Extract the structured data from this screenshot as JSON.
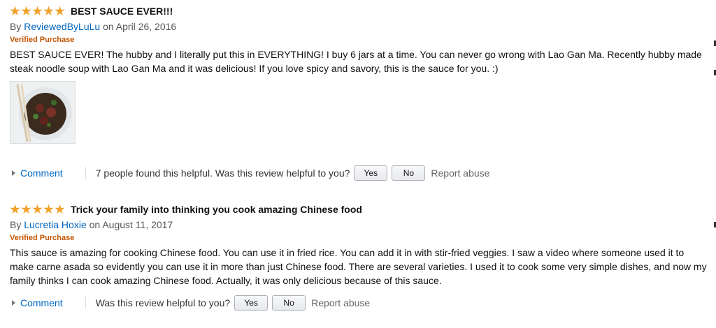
{
  "reviews": [
    {
      "stars": 5,
      "title": "BEST SAUCE EVER!!!",
      "by": "By",
      "author": "ReviewedByLuLu",
      "date": "on April 26, 2016",
      "verified": "Verified Purchase",
      "body": "BEST SAUCE EVER! The hubby and I literally put this in EVERYTHING! I buy 6 jars at a time. You can never go wrong with Lao Gan Ma. Recently hubby made steak noodle soup with Lao Gan Ma and it was delicious! If you love spicy and savory, this is the sauce for you. :)",
      "comment": "Comment",
      "helpful": "7 people found this helpful. Was this review helpful to you?",
      "yes": "Yes",
      "no": "No",
      "report": "Report abuse"
    },
    {
      "stars": 5,
      "title": "Trick your family into thinking you cook amazing Chinese food",
      "by": "By",
      "author": "Lucretia Hoxie",
      "date": "on August 11, 2017",
      "verified": "Verified Purchase",
      "body": "This sauce is amazing for cooking Chinese food. You can use it in fried rice. You can add it in with stir-fried veggies. I saw a video where someone used it to make carne asada so evidently you can use it in more than just Chinese food. There are several varieties. I used it to cook some very simple dishes, and now my family thinks I can cook amazing Chinese food. Actually, it was only delicious because of this sauce.",
      "comment": "Comment",
      "helpful": "Was this review helpful to you?",
      "yes": "Yes",
      "no": "No",
      "report": "Report abuse"
    }
  ],
  "colors": {
    "star": "#f0a22b",
    "link": "#0066c0",
    "verified": "#c45500"
  },
  "icons": [
    "star-icon",
    "expand-triangle-icon"
  ]
}
